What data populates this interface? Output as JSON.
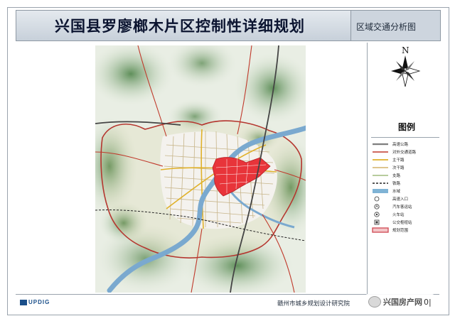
{
  "header": {
    "title": "兴国县罗廖榔木片区控制性详细规划",
    "subtitle": "区域交通分析图"
  },
  "compass": {
    "north_label": "N"
  },
  "legend": {
    "title": "图例",
    "items": [
      {
        "label": "高速公路",
        "swatch": "highway",
        "color": "#555555"
      },
      {
        "label": "对外交通道路",
        "swatch": "external-road",
        "color": "#c0392b"
      },
      {
        "label": "主干路",
        "swatch": "main-road",
        "color": "#e0b12a"
      },
      {
        "label": "次干路",
        "swatch": "secondary-road",
        "color": "#c9a24a"
      },
      {
        "label": "支路",
        "swatch": "branch-road",
        "color": "#6f9a3b"
      },
      {
        "label": "铁路",
        "swatch": "railway",
        "color": "#222222"
      },
      {
        "label": "水域",
        "swatch": "water",
        "color": "#7fb3d5"
      },
      {
        "label": "高速入口",
        "swatch": "circle-icon",
        "color": "#333333"
      },
      {
        "label": "汽车客运站",
        "swatch": "bus-station-icon",
        "color": "#333333"
      },
      {
        "label": "火车站",
        "swatch": "train-station-icon",
        "color": "#333333"
      },
      {
        "label": "公交枢纽站",
        "swatch": "bus-hub-icon",
        "color": "#333333"
      },
      {
        "label": "规划范围",
        "swatch": "plan-boundary",
        "color": "#d2525b"
      }
    ]
  },
  "footer": {
    "logo_text": "UPDIG",
    "organization": "赣州市城乡规划设计研究院"
  },
  "watermark": {
    "text": "兴国房产网",
    "suffix": "0|"
  },
  "colors": {
    "plan_area": "#e8343a",
    "river": "#7aa9cf",
    "hills": "#8fb58a",
    "boundary": "#b5362f"
  }
}
